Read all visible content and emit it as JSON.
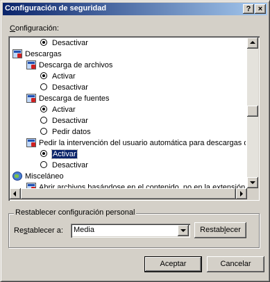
{
  "window": {
    "title": "Configuración de seguridad",
    "help_glyph": "?",
    "close_glyph": "×"
  },
  "settings_label": "Configuración:",
  "list": {
    "items": [
      {
        "text": "Desactivar",
        "kind": "radio",
        "checked": true
      },
      {
        "text": "Descargas",
        "kind": "category-icon"
      },
      {
        "text": "Descarga de archivos",
        "kind": "setting-icon"
      },
      {
        "text": "Activar",
        "kind": "radio",
        "checked": true
      },
      {
        "text": "Desactivar",
        "kind": "radio",
        "checked": false
      },
      {
        "text": "Descarga de fuentes",
        "kind": "setting-icon"
      },
      {
        "text": "Activar",
        "kind": "radio",
        "checked": true
      },
      {
        "text": "Desactivar",
        "kind": "radio",
        "checked": false
      },
      {
        "text": "Pedir datos",
        "kind": "radio",
        "checked": false
      },
      {
        "text": "Pedir la intervención del usuario automática para descargas de",
        "kind": "setting-icon"
      },
      {
        "text": "Activar",
        "kind": "radio",
        "checked": true,
        "selected": true
      },
      {
        "text": "Desactivar",
        "kind": "radio",
        "checked": false
      },
      {
        "text": "Misceláneo",
        "kind": "globe-icon"
      },
      {
        "text": "Abrir archivos basándose en el contenido, no en la extensión",
        "kind": "setting-icon"
      }
    ]
  },
  "reset_group": {
    "title": "Restablecer configuración personal",
    "label": "Restablecer a:",
    "level_value": "Media",
    "reset_button": "Restablecer"
  },
  "buttons": {
    "ok": "Aceptar",
    "cancel": "Cancelar"
  },
  "colors": {
    "title_start": "#0a246a",
    "title_end": "#a6caf0",
    "face": "#d4d0c8",
    "selection": "#0a246a"
  }
}
